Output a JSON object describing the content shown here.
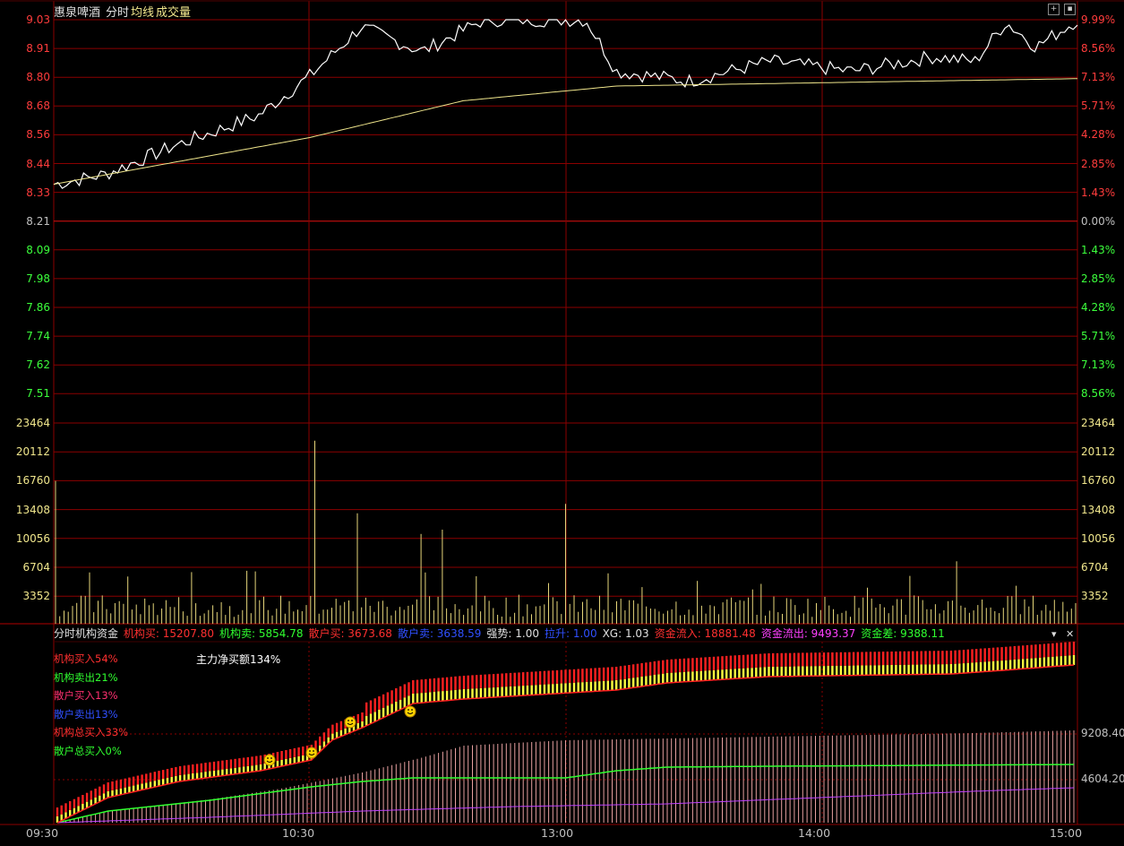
{
  "header": {
    "stock_name": "惠泉啤酒",
    "view_mode": "分时",
    "avg_line_label": "均线",
    "volume_label": "成交量"
  },
  "colors": {
    "grid": "#8b0000",
    "price_line": "#ffffff",
    "avg_line": "#f0e68c",
    "volume_bar": "#e6d67a",
    "up_text": "#ff3c3c",
    "down_text": "#3cff3c",
    "inst_buy": "#ff2020",
    "retail_buy": "#ffff40",
    "inflow_line": "#30ff30",
    "outflow_line": "#c040ff"
  },
  "price_axis": {
    "left_labels": [
      "9.03",
      "8.91",
      "8.80",
      "8.68",
      "8.56",
      "8.44",
      "8.33",
      "8.21",
      "8.09",
      "7.98",
      "7.86",
      "7.74",
      "7.62",
      "7.51"
    ],
    "right_labels": [
      "9.99%",
      "8.56%",
      "7.13%",
      "5.71%",
      "4.28%",
      "2.85%",
      "1.43%",
      "0.00%",
      "1.43%",
      "2.85%",
      "4.28%",
      "5.71%",
      "7.13%",
      "8.56%"
    ]
  },
  "volume_axis": {
    "labels": [
      "23464",
      "20112",
      "16760",
      "13408",
      "10056",
      "6704",
      "3352"
    ]
  },
  "indicator": {
    "name": "分时机构资金",
    "items": [
      {
        "label": "机构买: 15207.80",
        "color": "#ff3030"
      },
      {
        "label": "机构卖: 5854.78",
        "color": "#30ff30"
      },
      {
        "label": "散户买: 3673.68",
        "color": "#ff3030"
      },
      {
        "label": "散户卖: 3638.59",
        "color": "#3050ff"
      },
      {
        "label": "强势: 1.00",
        "color": "#e0e0e0"
      },
      {
        "label": "拉升: 1.00",
        "color": "#3050ff"
      },
      {
        "label": "XG: 1.03",
        "color": "#e0e0e0"
      },
      {
        "label": "资金流入: 18881.48",
        "color": "#ff3030"
      },
      {
        "label": "资金流出: 9493.37",
        "color": "#ff40ff"
      },
      {
        "label": "资金差: 9388.11",
        "color": "#30ff30"
      }
    ],
    "legend": [
      {
        "label": "机构买入54%",
        "color": "#ff3030"
      },
      {
        "label": "机构卖出21%",
        "color": "#30ff30"
      },
      {
        "label": "散户买入13%",
        "color": "#ff3070"
      },
      {
        "label": "散户卖出13%",
        "color": "#3050ff"
      },
      {
        "label": "机构总买入33%",
        "color": "#ff3030"
      },
      {
        "label": "散户总买入0%",
        "color": "#30ff30"
      }
    ],
    "net_buy_text": "主力净买额134%",
    "right_labels": [
      "9208.40",
      "4604.20"
    ]
  },
  "time_axis": {
    "labels": [
      "09:30",
      "10:30",
      "13:00",
      "14:00",
      "15:00"
    ]
  },
  "buttons": {
    "zoom_icon": "+",
    "close_icon": "▪",
    "collapse_icon": "▾",
    "close_panel_icon": "✕"
  },
  "chart_data": {
    "type": "line",
    "title": "",
    "x": [
      "09:30",
      "10:30",
      "13:00",
      "14:00",
      "15:00"
    ],
    "series": [
      {
        "name": "分时",
        "values": [
          8.36,
          8.86,
          9.03,
          8.78,
          9.03
        ]
      },
      {
        "name": "均线",
        "values": [
          8.36,
          8.56,
          8.75,
          8.78,
          8.79
        ]
      }
    ],
    "ylim": [
      7.45,
      9.03
    ],
    "prev_close": 8.21,
    "volume": {
      "ylim": [
        0,
        23464
      ],
      "notable": [
        {
          "time": "09:30",
          "value": 16700
        },
        {
          "time": "10:30",
          "value": 21400
        },
        {
          "time": "13:00",
          "value": 14000
        },
        {
          "time": "14:50",
          "value": 7300
        }
      ]
    },
    "fund_flow": {
      "inflow": 18881.48,
      "outflow": 9493.37,
      "difference": 9388.11
    }
  }
}
